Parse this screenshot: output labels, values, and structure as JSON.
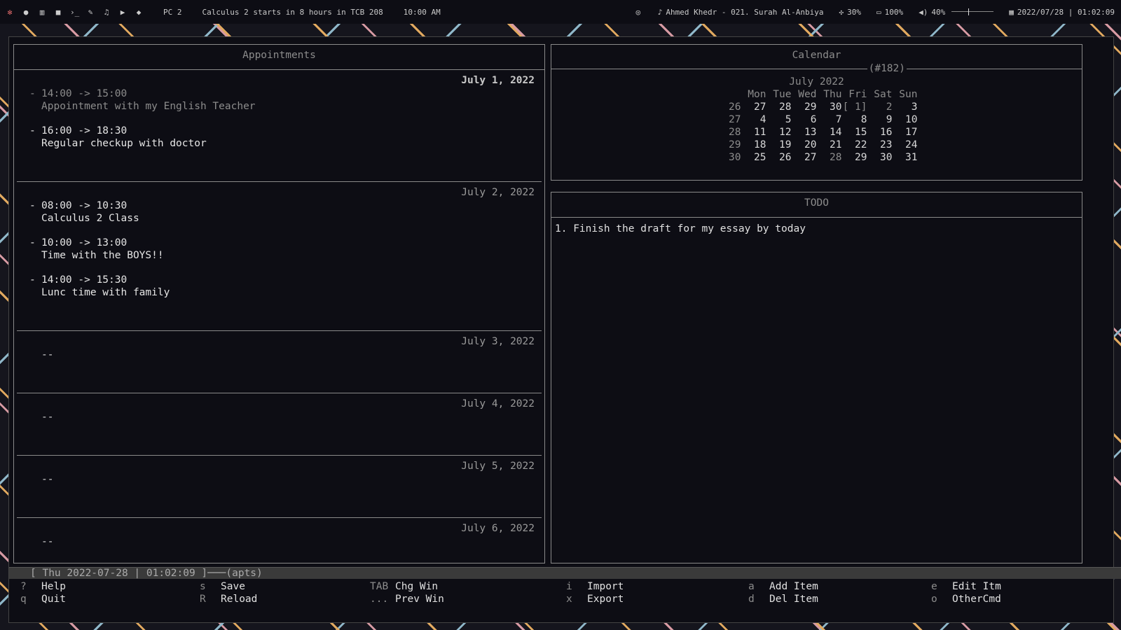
{
  "topbar": {
    "workspace": "PC 2",
    "notice": "Calculus 2 starts in 8 hours in TCB 208",
    "notice_time": "10:00 AM",
    "now_playing": "Ahmed Khedr - 021. Surah Al-Anbiya",
    "cpu": "30%",
    "battery": "100%",
    "volume": "40%",
    "volume_level": 0.4,
    "datetime": "2022/07/28 | 01:02:09"
  },
  "appointments": {
    "title": "Appointments",
    "days": [
      {
        "date": "July  1, 2022",
        "items": [
          {
            "time": "14:00 -> 15:00",
            "desc": "Appointment with my English Teacher"
          },
          {
            "time": "16:00 -> 18:30",
            "desc": "Regular checkup with doctor"
          }
        ]
      },
      {
        "date": "July  2, 2022",
        "items": [
          {
            "time": "08:00 -> 10:30",
            "desc": "Calculus 2 Class"
          },
          {
            "time": "10:00 -> 13:00",
            "desc": "Time with the BOYS!!"
          },
          {
            "time": "14:00 -> 15:30",
            "desc": "Lunc time with family"
          }
        ]
      },
      {
        "date": "July  3, 2022",
        "empty": "--"
      },
      {
        "date": "July  4, 2022",
        "empty": "--"
      },
      {
        "date": "July  5, 2022",
        "empty": "--"
      },
      {
        "date": "July  6, 2022",
        "empty": "--"
      }
    ]
  },
  "calendar": {
    "title": "Calendar",
    "day_number": "(#182)",
    "month": "July 2022",
    "weekdays": [
      "Mon",
      "Tue",
      "Wed",
      "Thu",
      "Fri",
      "Sat",
      "Sun"
    ],
    "weeks": [
      {
        "week": "26",
        "days": [
          "27",
          "28",
          "29",
          "30",
          "[ 1]",
          "2",
          "3"
        ]
      },
      {
        "week": "27",
        "days": [
          "4",
          "5",
          "6",
          "7",
          "8",
          "9",
          "10"
        ]
      },
      {
        "week": "28",
        "days": [
          "11",
          "12",
          "13",
          "14",
          "15",
          "16",
          "17"
        ]
      },
      {
        "week": "29",
        "days": [
          "18",
          "19",
          "20",
          "21",
          "22",
          "23",
          "24"
        ]
      },
      {
        "week": "30",
        "days": [
          "25",
          "26",
          "27",
          "28",
          "29",
          "30",
          "31"
        ]
      }
    ]
  },
  "todo": {
    "title": "TODO",
    "items": [
      "1. Finish the draft for my essay by today"
    ]
  },
  "status": {
    "text": "[ Thu 2022-07-28 | 01:02:09 ]",
    "mode": "(apts)"
  },
  "keys": [
    {
      "key": "?",
      "label": "Help"
    },
    {
      "key": "s",
      "label": "Save"
    },
    {
      "key": "TAB",
      "label": "Chg Win"
    },
    {
      "key": "i",
      "label": "Import"
    },
    {
      "key": "a",
      "label": "Add Item"
    },
    {
      "key": "e",
      "label": "Edit Itm"
    },
    {
      "key": "q",
      "label": "Quit"
    },
    {
      "key": "R",
      "label": "Reload"
    },
    {
      "key": "...",
      "label": "Prev Win"
    },
    {
      "key": "x",
      "label": "Export"
    },
    {
      "key": "d",
      "label": "Del Item"
    },
    {
      "key": "o",
      "label": "OtherCmd"
    }
  ]
}
